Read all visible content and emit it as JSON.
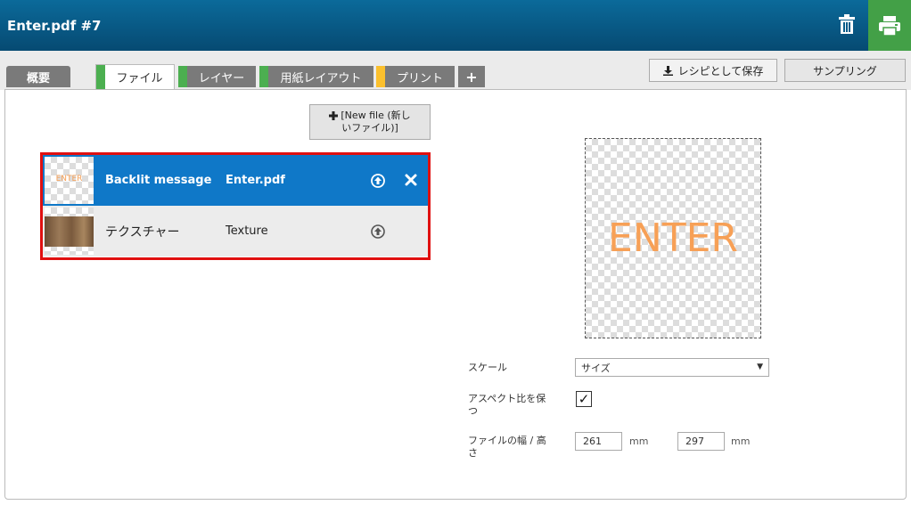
{
  "header": {
    "title": "Enter.pdf #7"
  },
  "tabs": [
    {
      "label": "概要",
      "color": "#7a7a7a"
    },
    {
      "label": "ファイル",
      "color": "#4caf50"
    },
    {
      "label": "レイヤー",
      "color": "#4caf50"
    },
    {
      "label": "用紙レイアウト",
      "color": "#4caf50"
    },
    {
      "label": "プリント",
      "color": "#fbc02d"
    },
    {
      "label": "+"
    }
  ],
  "toolbar": {
    "save_recipe_label": "レシピとして保存",
    "sampling_label": "サンプリング"
  },
  "new_file": {
    "line1": "[New file (新し",
    "line2": "いファイル)]"
  },
  "files": [
    {
      "thumb_text": "ENTER",
      "name": "Backlit message",
      "source": "Enter.pdf",
      "selected": true
    },
    {
      "name": "テクスチャー",
      "source": "Texture",
      "selected": false
    }
  ],
  "preview": {
    "text": "ENTER"
  },
  "form": {
    "scale_label": "スケール",
    "scale_value": "サイズ",
    "aspect_label_1": "アスペクト比を保",
    "aspect_label_2": "つ",
    "aspect_checked": true,
    "check_mark": "✓",
    "size_label_1": "ファイルの幅 / 高",
    "size_label_2": "さ",
    "width_value": "261",
    "height_value": "297",
    "unit": "mm"
  },
  "colors": {
    "header": "#085c8a",
    "selected_row": "#0f78c8",
    "highlight_border": "#e01010",
    "print_button": "#43a047",
    "preview_text": "#f7a056"
  }
}
